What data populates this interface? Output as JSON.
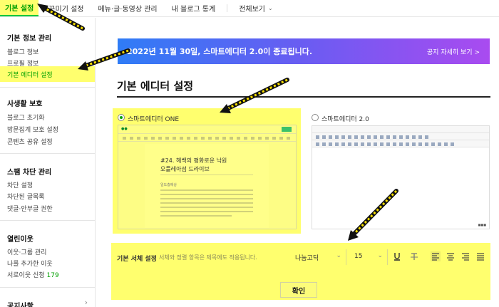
{
  "topnav": {
    "tabs": [
      {
        "label": "기본 설정"
      },
      {
        "label": "꾸미기 설정"
      },
      {
        "label": "메뉴·글·동영상 관리"
      },
      {
        "label": "내 블로그 통계"
      },
      {
        "label": "전체보기"
      }
    ]
  },
  "sidebar": {
    "groups": [
      {
        "title": "기본 정보 관리",
        "items": [
          "블로그 정보",
          "프로필 정보",
          "기본 에디터 설정"
        ]
      },
      {
        "title": "사생활 보호",
        "items": [
          "블로그 초기화",
          "방문집계 보호 설정",
          "콘텐츠 공유 설정"
        ]
      },
      {
        "title": "스팸 차단 관리",
        "items": [
          "차단 설정",
          "차단된 글목록",
          "댓글·안부글 권한"
        ]
      },
      {
        "title": "열린이웃",
        "items": [
          "이웃·그룹 관리",
          "나를 추가한 이웃",
          "서로이웃 신청"
        ],
        "count": "179"
      },
      {
        "title": "공지사항"
      }
    ]
  },
  "banner": {
    "message": "2022년 11월 30일, 스마트에디터 2.0이 종료됩니다.",
    "link": "공지 자세히 보기 >"
  },
  "section_title": "기본 에디터 설정",
  "options": [
    {
      "label": "스마트에디터 ONE",
      "selected": true
    },
    {
      "label": "스마트에디터 2.0",
      "selected": false
    }
  ],
  "preview_one": {
    "title_line1": "#24. 헤백의 평화로운 낙원",
    "title_line2": "오를레아섬 드라이브",
    "subtitle": "일도층에상"
  },
  "font_settings": {
    "label": "기본 서체 설정",
    "description": "서체와 정렬 항목은 제목에도 적용됩니다.",
    "font": "나눔고딕",
    "size": "15",
    "confirm": "확인"
  },
  "icons": {
    "underline": "underline-icon",
    "strike": "strikethrough-icon",
    "align_left": "align-left-icon",
    "align_center": "align-center-icon",
    "align_right": "align-right-icon",
    "align_justify": "align-justify-icon"
  },
  "colors": {
    "highlight": "#ffff6e",
    "accent": "#00a000",
    "arrow": "#f5dd00"
  }
}
